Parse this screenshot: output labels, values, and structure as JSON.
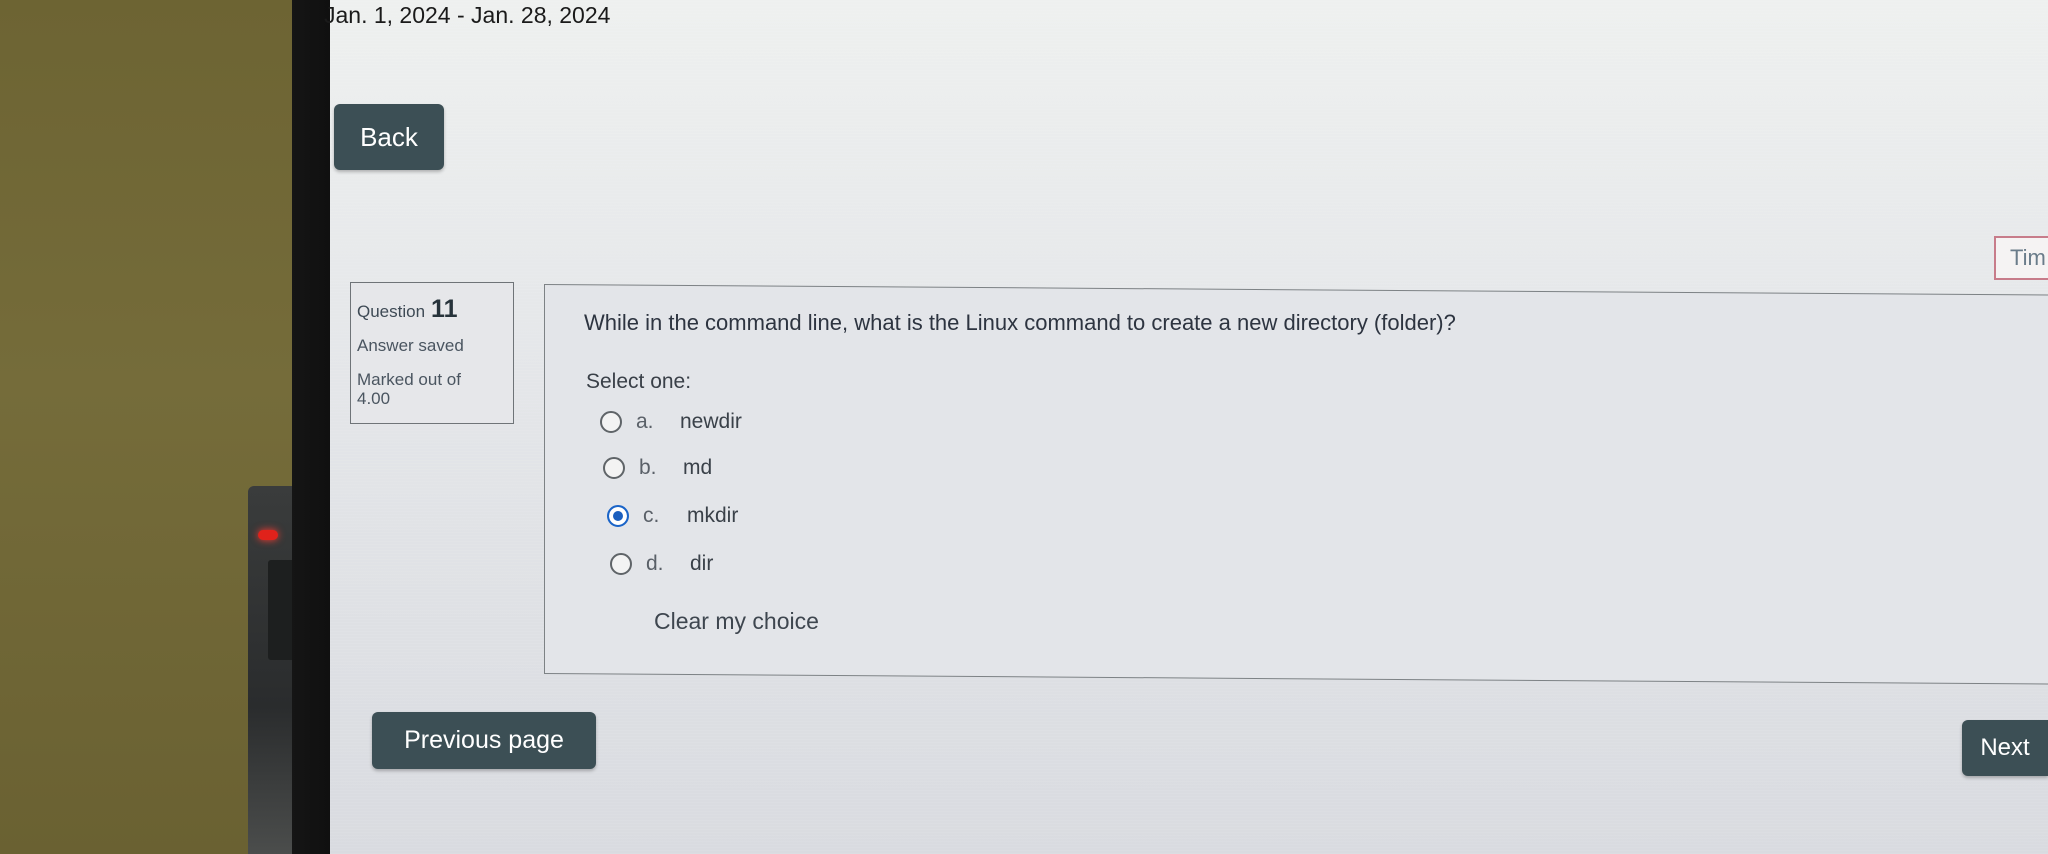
{
  "header": {
    "date_range": "Jan. 1, 2024 - Jan. 28, 2024"
  },
  "navigation": {
    "back_label": "Back",
    "previous_label": "Previous page",
    "next_label": "Next",
    "timer_label": "Tim"
  },
  "question_info": {
    "question_word": "Question",
    "number": "11",
    "status": "Answer saved",
    "marked_out_of": "Marked out of",
    "points": "4.00"
  },
  "question": {
    "text": "While in the command line, what is the Linux command to create a new directory (folder)?",
    "select_prompt": "Select one:",
    "options": [
      {
        "letter": "a.",
        "label": "newdir",
        "selected": false
      },
      {
        "letter": "b.",
        "label": "md",
        "selected": false
      },
      {
        "letter": "c.",
        "label": "mkdir",
        "selected": true
      },
      {
        "letter": "d.",
        "label": "dir",
        "selected": false
      }
    ],
    "clear_label": "Clear my choice"
  },
  "colors": {
    "button_bg": "#3c4f55",
    "radio_selected": "#1b5fbf",
    "device_led": "#e0221b"
  }
}
